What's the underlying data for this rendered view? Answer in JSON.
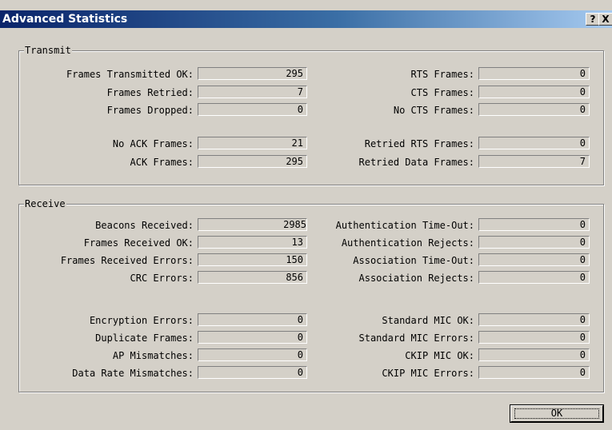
{
  "window": {
    "title": "Advanced Statistics",
    "help_label": "?",
    "close_label": "X"
  },
  "transmit": {
    "legend": "Transmit",
    "left": [
      {
        "label": "Frames Transmitted OK:",
        "value": "295"
      },
      {
        "label": "Frames Retried:",
        "value": "7"
      },
      {
        "label": "Frames Dropped:",
        "value": "0"
      },
      {
        "label": "No ACK Frames:",
        "value": "21"
      },
      {
        "label": "ACK Frames:",
        "value": "295"
      }
    ],
    "right": [
      {
        "label": "RTS Frames:",
        "value": "0"
      },
      {
        "label": "CTS Frames:",
        "value": "0"
      },
      {
        "label": "No CTS Frames:",
        "value": "0"
      },
      {
        "label": "Retried RTS Frames:",
        "value": "0"
      },
      {
        "label": "Retried Data Frames:",
        "value": "7"
      }
    ]
  },
  "receive": {
    "legend": "Receive",
    "left": [
      {
        "label": "Beacons Received:",
        "value": "2985"
      },
      {
        "label": "Frames Received OK:",
        "value": "13"
      },
      {
        "label": "Frames Received Errors:",
        "value": "150"
      },
      {
        "label": "CRC Errors:",
        "value": "856"
      },
      {
        "label": "Encryption Errors:",
        "value": "0"
      },
      {
        "label": "Duplicate Frames:",
        "value": "0"
      },
      {
        "label": "AP Mismatches:",
        "value": "0"
      },
      {
        "label": "Data Rate Mismatches:",
        "value": "0"
      }
    ],
    "right": [
      {
        "label": "Authentication Time-Out:",
        "value": "0"
      },
      {
        "label": "Authentication Rejects:",
        "value": "0"
      },
      {
        "label": "Association Time-Out:",
        "value": "0"
      },
      {
        "label": "Association Rejects:",
        "value": "0"
      },
      {
        "label": "Standard MIC OK:",
        "value": "0"
      },
      {
        "label": "Standard MIC Errors:",
        "value": "0"
      },
      {
        "label": "CKIP MIC OK:",
        "value": "0"
      },
      {
        "label": "CKIP MIC Errors:",
        "value": "0"
      }
    ]
  },
  "buttons": {
    "ok_label": "OK"
  }
}
